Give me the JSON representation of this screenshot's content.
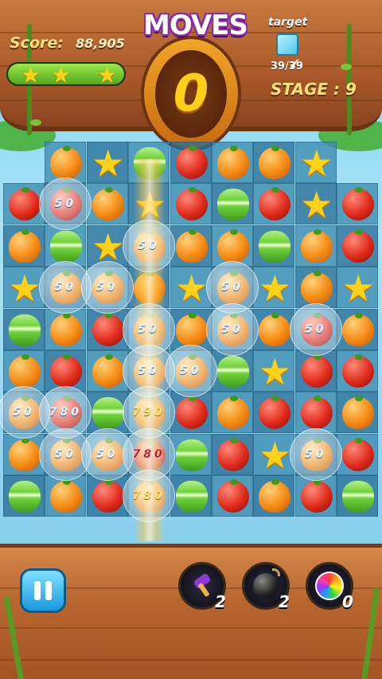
{
  "hud": {
    "score_label": "Score:",
    "score_value": "88,905",
    "stars_earned": 3,
    "star_progress_fraction": 1.0,
    "moves_title": "MOVES",
    "moves_value": "0",
    "target_label": "target",
    "target_count": "39/39",
    "target_item_icon": "ice-cube-icon",
    "stage_label": "STAGE : 9"
  },
  "board": {
    "columns": 9,
    "rows": 9,
    "grid": [
      [
        "",
        "orange",
        "star",
        "macaron",
        "tomato",
        "orange",
        "orange",
        "star",
        ""
      ],
      [
        "tomato",
        "tomato",
        "orange",
        "star",
        "tomato",
        "macaron",
        "tomato",
        "star",
        "tomato"
      ],
      [
        "orange",
        "macaron",
        "star",
        "orange",
        "orange",
        "orange",
        "macaron",
        "orange",
        "tomato"
      ],
      [
        "star",
        "orange",
        "orange",
        "orange",
        "star",
        "orange",
        "star",
        "orange",
        "star"
      ],
      [
        "macaron",
        "orange",
        "tomato",
        "orange",
        "orange",
        "orange",
        "orange",
        "tomato",
        "orange"
      ],
      [
        "orange",
        "tomato",
        "orange",
        "orange",
        "orange",
        "macaron",
        "star",
        "tomato",
        "tomato"
      ],
      [
        "orange",
        "tomato",
        "macaron",
        "orange",
        "tomato",
        "orange",
        "tomato",
        "tomato",
        "orange"
      ],
      [
        "orange",
        "orange",
        "orange",
        "tomato",
        "macaron",
        "tomato",
        "star",
        "orange",
        "tomato"
      ],
      [
        "macaron",
        "orange",
        "tomato",
        "orange",
        "macaron",
        "tomato",
        "orange",
        "tomato",
        "macaron"
      ]
    ],
    "score_popups": [
      {
        "text": "50",
        "row": 1,
        "col": 1,
        "style": "white"
      },
      {
        "text": "50",
        "row": 2,
        "col": 3,
        "style": "white"
      },
      {
        "text": "50",
        "row": 3,
        "col": 1,
        "style": "white"
      },
      {
        "text": "50",
        "row": 3,
        "col": 2,
        "style": "white"
      },
      {
        "text": "50",
        "row": 3,
        "col": 5,
        "style": "white"
      },
      {
        "text": "50",
        "row": 4,
        "col": 3,
        "style": "white"
      },
      {
        "text": "50",
        "row": 4,
        "col": 5,
        "style": "white"
      },
      {
        "text": "50",
        "row": 4,
        "col": 7,
        "style": "white"
      },
      {
        "text": "50",
        "row": 5,
        "col": 3,
        "style": "white"
      },
      {
        "text": "50",
        "row": 5,
        "col": 4,
        "style": "white"
      },
      {
        "text": "50",
        "row": 6,
        "col": 0,
        "style": "white"
      },
      {
        "text": "780",
        "row": 6,
        "col": 1,
        "style": "white"
      },
      {
        "text": "790",
        "row": 6,
        "col": 3,
        "style": "gold"
      },
      {
        "text": "50",
        "row": 7,
        "col": 1,
        "style": "white"
      },
      {
        "text": "50",
        "row": 7,
        "col": 2,
        "style": "white"
      },
      {
        "text": "780",
        "row": 7,
        "col": 3,
        "style": "red"
      },
      {
        "text": "50",
        "row": 7,
        "col": 7,
        "style": "white"
      },
      {
        "text": "780",
        "row": 8,
        "col": 3,
        "style": "gold"
      }
    ]
  },
  "controls": {
    "pause_icon": "pause-icon",
    "boosters": [
      {
        "name": "hammer",
        "icon": "hammer-icon",
        "count": "2"
      },
      {
        "name": "bomb",
        "icon": "bomb-icon",
        "count": "2"
      },
      {
        "name": "color-burst",
        "icon": "rainbow-candy-icon",
        "count": "0"
      }
    ]
  },
  "colors": {
    "wood": "#b8662e",
    "score_text": "#ffe07a",
    "moves_text": "#ffcf1a",
    "pause_button": "#1a9ae0"
  }
}
